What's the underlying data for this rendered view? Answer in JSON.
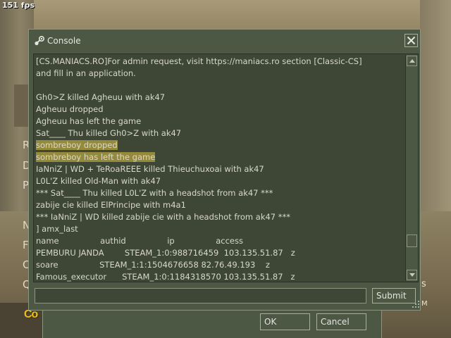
{
  "hud": {
    "fps": "151 fps"
  },
  "background": {
    "menu_letters": [
      "R",
      "D",
      "P",
      "N",
      "F",
      "C",
      "Q"
    ],
    "logo_fragment": "Co",
    "right_letters": [
      "s",
      "M"
    ]
  },
  "console": {
    "title": "Console",
    "icons": {
      "title": "steam-icon",
      "close": "close-icon"
    },
    "log_lines": [
      {
        "text": "[CS.MANIACS.RO]For admin request, visit https://maniacs.ro section [Classic-CS]",
        "highlight": false
      },
      {
        "text": "and fill in an application.",
        "highlight": false
      },
      {
        "text": "",
        "highlight": false
      },
      {
        "text": "Gh0>Z killed Agheuu with ak47",
        "highlight": false
      },
      {
        "text": "Agheuu dropped",
        "highlight": false
      },
      {
        "text": "Agheuu has left the game",
        "highlight": false
      },
      {
        "text": "Sat____ Thu killed Gh0>Z with ak47",
        "highlight": false
      },
      {
        "text": "sombreboy dropped",
        "highlight": true
      },
      {
        "text": "sombreboy has left the game",
        "highlight": true
      },
      {
        "text": "IaNniZ | WD + TeRoaREEE killed Thieuchuxoai with ak47",
        "highlight": false
      },
      {
        "text": "L0L'Z killed Old-Man with ak47",
        "highlight": false
      },
      {
        "text": "*** Sat____ Thu killed L0L'Z with a headshot from ak47 ***",
        "highlight": false
      },
      {
        "text": "zabije cie killed ElPrincipe with m4a1",
        "highlight": false
      },
      {
        "text": "*** IaNniZ | WD killed zabije cie with a headshot from ak47 ***",
        "highlight": false
      },
      {
        "text": "] amx_last",
        "highlight": false
      },
      {
        "text": "name                authid                ip                access",
        "highlight": false
      },
      {
        "text": "PEMBURU JANDA        STEAM_1:0:988716459  103.135.51.87   z",
        "highlight": false
      },
      {
        "text": "soare                STEAM_1:1:1504676658 82.76.49.193    z",
        "highlight": false
      },
      {
        "text": "Famous_executor      STEAM_1:0:1184318570 103.135.51.87   z",
        "highlight": false
      }
    ],
    "input": {
      "value": "",
      "placeholder": ""
    },
    "submit_label": "Submit"
  },
  "dialog": {
    "ok_label": "OK",
    "cancel_label": "Cancel"
  },
  "colors": {
    "panel": "#4c5844",
    "log_bg": "#3e4636",
    "text": "#d8d8c8",
    "highlight": "#958a3b",
    "logo": "#f0c010"
  }
}
